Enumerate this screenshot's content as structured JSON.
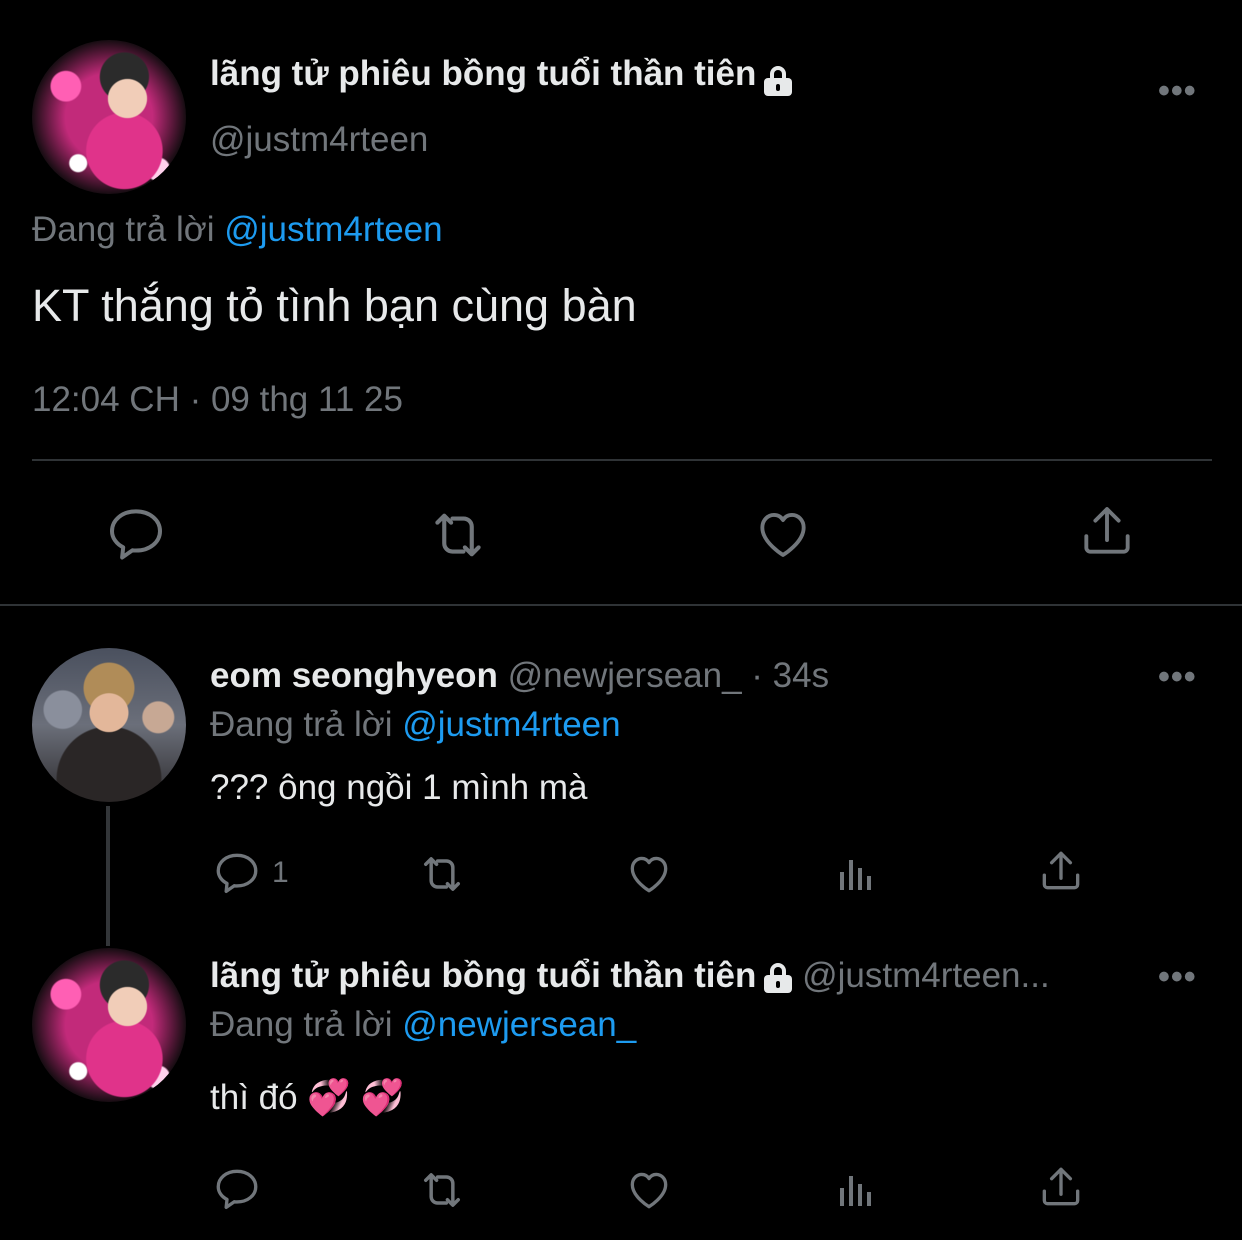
{
  "main_tweet": {
    "display_name": "lãng tử phiêu bồng tuổi thần tiên",
    "handle": "@justm4rteen",
    "replying_prefix": "Đang trả lời",
    "replying_to": "@justm4rteen",
    "text": "KT thắng tỏ tình bạn cùng bàn",
    "timestamp": "12:04 CH · 09 thg 11 25",
    "more_glyph": "•••"
  },
  "reply1": {
    "display_name": "eom seonghyeon",
    "handle": "@newjersean_",
    "time": "· 34s",
    "replying_prefix": "Đang trả lời",
    "replying_to": "@justm4rteen",
    "text": "??? ông ngồi 1 mình mà",
    "reply_count": "1",
    "more_glyph": "•••"
  },
  "reply2": {
    "display_name": "lãng tử phiêu bồng tuổi thần tiên",
    "handle": "@justm4rteen...",
    "replying_prefix": "Đang trả lời",
    "replying_to": "@newjersean_",
    "text": "thì đó 💞 💞",
    "more_glyph": "•••"
  },
  "icons": [
    "reply-icon",
    "retweet-icon",
    "like-icon",
    "share-icon",
    "views-icon",
    "lock-icon",
    "more-icon"
  ],
  "colors": {
    "background": "#000000",
    "text": "#e7e9ea",
    "muted": "#71767b",
    "link": "#1d9bf0",
    "divider": "#2f3336"
  }
}
